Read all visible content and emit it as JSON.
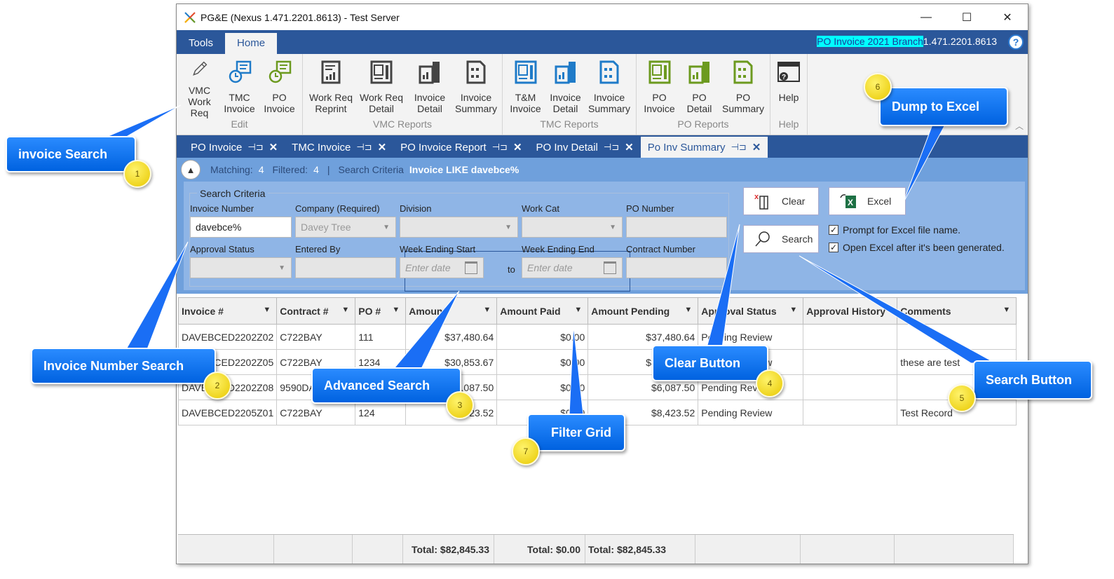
{
  "window": {
    "title": "PG&E (Nexus 1.471.2201.8613) - Test Server",
    "controls": {
      "minimize": "—",
      "maximize": "☐",
      "close": "✕"
    }
  },
  "menubar": {
    "tabs": [
      {
        "label": "Tools"
      },
      {
        "label": "Home",
        "active": true
      }
    ],
    "branch_highlight": "PO Invoice 2021 Branch",
    "version": "1.471.2201.8613",
    "help_icon": "?"
  },
  "ribbon": {
    "groups": [
      {
        "label": "Edit",
        "buttons": [
          {
            "line1": "VMC",
            "line2": "Work Req",
            "icon": "pencil-icon"
          },
          {
            "line1": "TMC",
            "line2": "Invoice",
            "icon": "clock-invoice-icon"
          },
          {
            "line1": "PO",
            "line2": "Invoice",
            "icon": "clock-invoice-icon"
          }
        ]
      },
      {
        "label": "VMC Reports",
        "buttons": [
          {
            "line1": "Work Req",
            "line2": "Reprint",
            "icon": "report-icon"
          },
          {
            "line1": "Work Req",
            "line2": "Detail",
            "icon": "report-detail-icon"
          },
          {
            "line1": "Invoice",
            "line2": "Detail",
            "icon": "invoice-detail-icon"
          },
          {
            "line1": "Invoice",
            "line2": "Summary",
            "icon": "summary-icon"
          }
        ]
      },
      {
        "label": "TMC Reports",
        "buttons": [
          {
            "line1": "T&M",
            "line2": "Invoice",
            "icon": "report-detail-icon"
          },
          {
            "line1": "Invoice",
            "line2": "Detail",
            "icon": "invoice-detail-icon"
          },
          {
            "line1": "Invoice",
            "line2": "Summary",
            "icon": "summary-icon"
          }
        ]
      },
      {
        "label": "PO Reports",
        "buttons": [
          {
            "line1": "PO",
            "line2": "Invoice",
            "icon": "report-detail-icon"
          },
          {
            "line1": "PO",
            "line2": "Detail",
            "icon": "invoice-detail-icon"
          },
          {
            "line1": "PO",
            "line2": "Summary",
            "icon": "summary-icon"
          }
        ]
      },
      {
        "label": "Help",
        "buttons": [
          {
            "line1": "Help",
            "line2": "",
            "icon": "help-window-icon"
          }
        ]
      }
    ],
    "colors": {
      "edit_blue": "#1f7bc8",
      "edit_green": "#6c9a1f",
      "vmc": "#444444",
      "tmc": "#1f7bc8",
      "po": "#6c9a1f"
    }
  },
  "doc_tabs": [
    {
      "label": "PO Invoice"
    },
    {
      "label": "TMC Invoice"
    },
    {
      "label": "PO Invoice Report"
    },
    {
      "label": "PO Inv Detail"
    },
    {
      "label": "Po Inv Summary",
      "active": true
    }
  ],
  "infobar": {
    "matching_label": "Matching:",
    "matching": "4",
    "filtered_label": "Filtered:",
    "filtered": "4",
    "separator": "|",
    "criteria_label": "Search Criteria",
    "criteria": "Invoice LIKE davebce%"
  },
  "search": {
    "legend": "Search Criteria",
    "fields": {
      "invoice_number": {
        "label": "Invoice Number",
        "value": "davebce%"
      },
      "company": {
        "label": "Company (Required)",
        "value": "Davey Tree"
      },
      "division": {
        "label": "Division",
        "value": ""
      },
      "work_cat": {
        "label": "Work Cat",
        "value": ""
      },
      "po_number": {
        "label": "PO Number",
        "value": ""
      },
      "approval_status": {
        "label": "Approval Status",
        "value": ""
      },
      "entered_by": {
        "label": "Entered By",
        "value": ""
      },
      "week_start": {
        "label": "Week Ending Start",
        "placeholder": "Enter date"
      },
      "to": "to",
      "week_end": {
        "label": "Week Ending End",
        "placeholder": "Enter date"
      },
      "contract_number": {
        "label": "Contract Number",
        "value": ""
      }
    },
    "buttons": {
      "clear": "Clear",
      "search": "Search",
      "excel": "Excel"
    },
    "options": {
      "prompt_filename": {
        "label": "Prompt for Excel file name.",
        "checked": true
      },
      "open_excel": {
        "label": "Open Excel after it's been generated.",
        "checked": true
      }
    }
  },
  "grid": {
    "columns": [
      "Invoice #",
      "Contract #",
      "PO #",
      "Amount",
      "Amount Paid",
      "Amount Pending",
      "Approval Status",
      "Approval History",
      "Comments"
    ],
    "filterable": [
      true,
      true,
      true,
      true,
      true,
      true,
      true,
      false,
      true
    ],
    "rows": [
      [
        "DAVEBCED2202Z02",
        "C722BAY",
        "111",
        "$37,480.64",
        "$0.00",
        "$37,480.64",
        "Pending Review",
        "",
        ""
      ],
      [
        "DAVEBCED2202Z05",
        "C722BAY",
        "1234",
        "$30,853.67",
        "$0.00",
        "$30,853.67",
        "Pending Review",
        "",
        "these are test"
      ],
      [
        "DAVEBCED2202Z08",
        "9590DA",
        "",
        "$6,087.50",
        "$0.00",
        "$6,087.50",
        "Pending Review",
        "",
        ""
      ],
      [
        "DAVEBCED2205Z01",
        "C722BAY",
        "124",
        "$8,423.52",
        "$0.00",
        "$8,423.52",
        "Pending Review",
        "",
        "Test Record"
      ]
    ],
    "totals": {
      "amount": "Total: $82,845.33",
      "paid": "Total: $0.00",
      "pending": "Total: $82,845.33"
    }
  },
  "annotations": [
    {
      "label": "invoice Search",
      "number": "1"
    },
    {
      "label": "Invoice Number Search",
      "number": "2"
    },
    {
      "label": "Advanced Search",
      "number": "3"
    },
    {
      "label": "Clear Button",
      "number": "4"
    },
    {
      "label": "Search Button",
      "number": "5"
    },
    {
      "label": "Dump to Excel",
      "number": "6"
    },
    {
      "label": "Filter Grid",
      "number": "7"
    }
  ]
}
